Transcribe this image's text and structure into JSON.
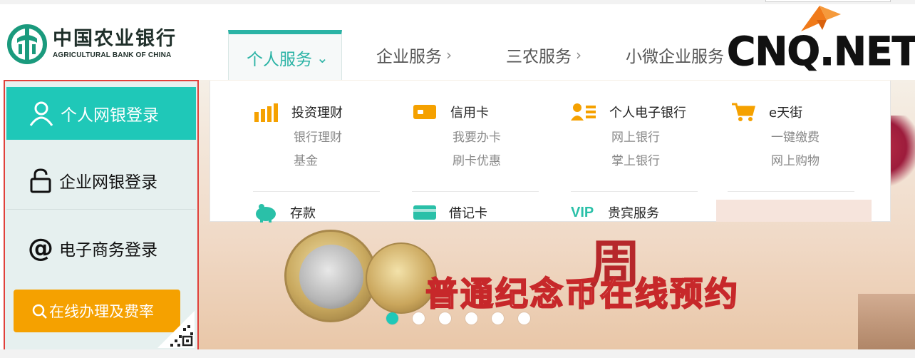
{
  "bank": {
    "name_cn": "中国农业银行",
    "name_en": "AGRICULTURAL BANK OF CHINA",
    "logo_icon": "abc-bank-logo-icon"
  },
  "watermark": {
    "text": "CNQ.NET"
  },
  "nav": {
    "tabs": [
      {
        "label": "个人服务",
        "active": true,
        "chevron": "⌄"
      },
      {
        "label": "企业服务",
        "active": false,
        "chevron": "›"
      },
      {
        "label": "三农服务",
        "active": false,
        "chevron": "›"
      },
      {
        "label": "小微企业服务",
        "active": false,
        "chevron": "›"
      }
    ]
  },
  "login": {
    "personal": "个人网银登录",
    "corporate": "企业网银登录",
    "ecommerce": "电子商务登录",
    "online": "在线办理及费率"
  },
  "menu": {
    "categories": [
      {
        "title": "投资理财",
        "icon": "bar-chart-icon",
        "items": [
          "银行理财",
          "基金"
        ]
      },
      {
        "title": "信用卡",
        "icon": "credit-card-icon",
        "items": [
          "我要办卡",
          "刷卡优惠"
        ]
      },
      {
        "title": "个人电子银行",
        "icon": "user-list-icon",
        "items": [
          "网上银行",
          "掌上银行"
        ]
      },
      {
        "title": "e天街",
        "icon": "shopping-cart-icon",
        "items": [
          "一键缴费",
          "网上购物"
        ]
      }
    ],
    "second_row": [
      {
        "title": "存款",
        "icon": "piggy-bank-icon"
      },
      {
        "title": "借记卡",
        "icon": "debit-card-icon"
      },
      {
        "title": "贵宾服务",
        "icon": "vip-icon",
        "badge": "VIP"
      }
    ]
  },
  "banner": {
    "headline": "普通纪念币在线预约",
    "slides": 6,
    "active_slide": 1
  },
  "colors": {
    "teal": "#1fc8b8",
    "orange": "#f5a100",
    "red_border": "#e0403a"
  }
}
